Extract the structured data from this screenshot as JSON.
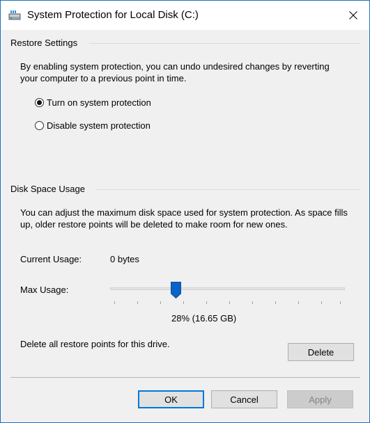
{
  "window": {
    "title": "System Protection for Local Disk (C:)",
    "icon": "disk-drive-icon",
    "close_icon": "close-icon"
  },
  "restore_settings": {
    "group_title": "Restore Settings",
    "description": "By enabling system protection, you can undo undesired changes by reverting your computer to a previous point in time.",
    "options": [
      {
        "label": "Turn on system protection",
        "checked": true
      },
      {
        "label": "Disable system protection",
        "checked": false
      }
    ]
  },
  "disk_space": {
    "group_title": "Disk Space Usage",
    "description": "You can adjust the maximum disk space used for system protection. As space fills up, older restore points will be deleted to make room for new ones.",
    "current_usage_label": "Current Usage:",
    "current_usage_value": "0 bytes",
    "max_usage_label": "Max Usage:",
    "max_usage_percent": 28,
    "max_usage_text": "28% (16.65 GB)",
    "delete_text": "Delete all restore points for this drive.",
    "delete_label": "Delete"
  },
  "footer": {
    "ok_label": "OK",
    "cancel_label": "Cancel",
    "apply_label": "Apply",
    "apply_disabled": true
  },
  "colors": {
    "accent": "#0078d7",
    "slider_thumb": "#0a64c8"
  }
}
